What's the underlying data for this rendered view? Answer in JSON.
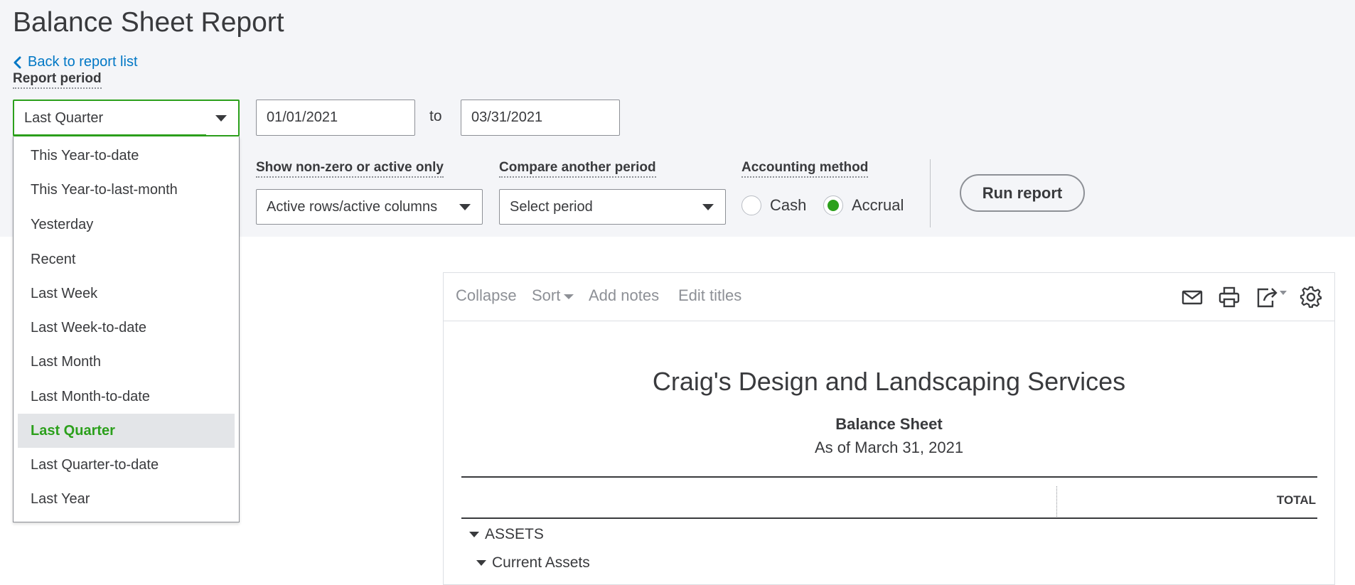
{
  "page": {
    "title": "Balance Sheet Report",
    "back_link": "Back to report list"
  },
  "filters": {
    "report_period_label": "Report period",
    "period_selected": "Last Quarter",
    "date_from": "01/01/2021",
    "to_label": "to",
    "date_to": "03/31/2021",
    "period_options": [
      "This Year-to-date",
      "This Year-to-last-month",
      "Yesterday",
      "Recent",
      "Last Week",
      "Last Week-to-date",
      "Last Month",
      "Last Month-to-date",
      "Last Quarter",
      "Last Quarter-to-date",
      "Last Year"
    ],
    "nonzero_label": "Show non-zero or active only",
    "nonzero_value": "Active rows/active columns",
    "compare_label": "Compare another period",
    "compare_value": "Select period",
    "accounting_label": "Accounting method",
    "cash_label": "Cash",
    "accrual_label": "Accrual",
    "accounting_selected": "Accrual",
    "run_button": "Run report"
  },
  "toolbar": {
    "collapse": "Collapse",
    "sort": "Sort",
    "add_notes": "Add notes",
    "edit_titles": "Edit titles",
    "icons": [
      "email-icon",
      "print-icon",
      "export-icon",
      "settings-gear-icon"
    ]
  },
  "report": {
    "company": "Craig's Design and Landscaping Services",
    "title": "Balance Sheet",
    "date": "As of March 31, 2021",
    "total_header": "TOTAL",
    "rows": [
      {
        "label": "ASSETS",
        "level": 0
      },
      {
        "label": "Current Assets",
        "level": 1
      }
    ]
  },
  "colors": {
    "accent_green": "#2ca01c",
    "link_blue": "#0077c5",
    "text": "#393a3d",
    "muted": "#8d9096",
    "top_bg": "#f4f5f8"
  }
}
